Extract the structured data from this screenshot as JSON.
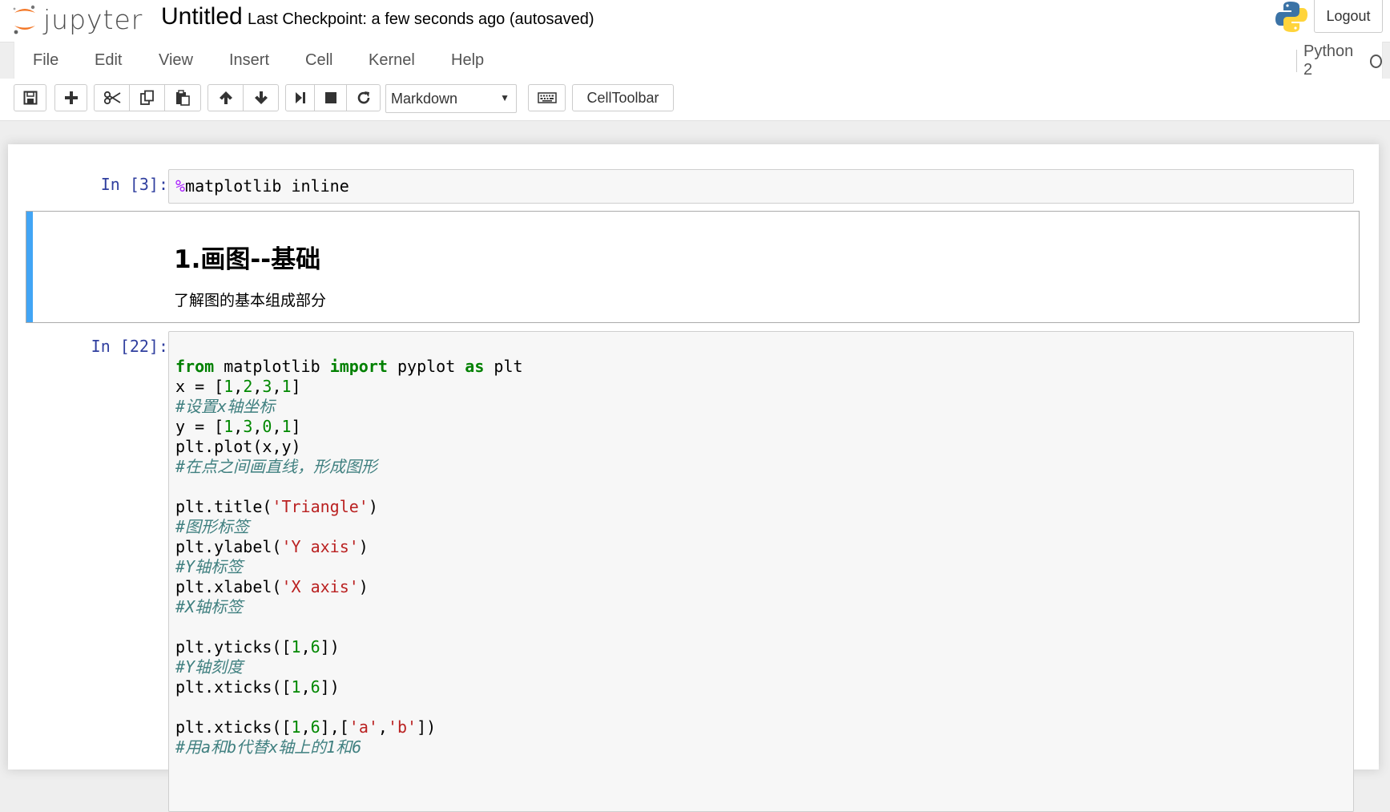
{
  "header": {
    "logo_text": "jupyter",
    "notebook_title": "Untitled",
    "checkpoint": "Last Checkpoint: a few seconds ago (autosaved)",
    "logout_label": "Logout"
  },
  "menubar": {
    "items": [
      "File",
      "Edit",
      "View",
      "Insert",
      "Cell",
      "Kernel",
      "Help"
    ],
    "kernel_name": "Python 2"
  },
  "toolbar": {
    "buttons": [
      "save-icon",
      "plus-icon",
      "scissors-icon",
      "copy-icon",
      "paste-icon",
      "arrow-up-icon",
      "arrow-down-icon",
      "step-forward-icon",
      "stop-icon",
      "refresh-icon",
      "keyboard-icon"
    ],
    "cell_type": "Markdown",
    "celltoolbar_label": "CellToolbar"
  },
  "cells": {
    "c1": {
      "prompt": "In [3]:",
      "magic": "%",
      "code": "matplotlib inline"
    },
    "md": {
      "heading": "1.画图--基础",
      "paragraph": "了解图的基本组成部分"
    },
    "c2": {
      "prompt": "In [22]:",
      "lines": [
        "from matplotlib import pyplot as plt",
        "x = [1,2,3,1]",
        "#设置x轴坐标",
        "y = [1,3,0,1]",
        "plt.plot(x,y)",
        "#在点之间画直线，形成图形",
        "",
        "plt.title('Triangle')",
        "#图形标签",
        "plt.ylabel('Y axis')",
        "#Y轴标签",
        "plt.xlabel('X axis')",
        "#X轴标签",
        "",
        "plt.yticks([1,6])",
        "#Y轴刻度",
        "plt.xticks([1,6])",
        "",
        "plt.xticks([1,6],['a','b'])",
        "#用a和b代替x轴上的1和6"
      ]
    }
  },
  "colors": {
    "keyword": "#008000",
    "number": "#008800",
    "string": "#ba2121",
    "comment": "#408080",
    "prompt": "#303f9f",
    "selected_cell_bar": "#42a5f5"
  }
}
